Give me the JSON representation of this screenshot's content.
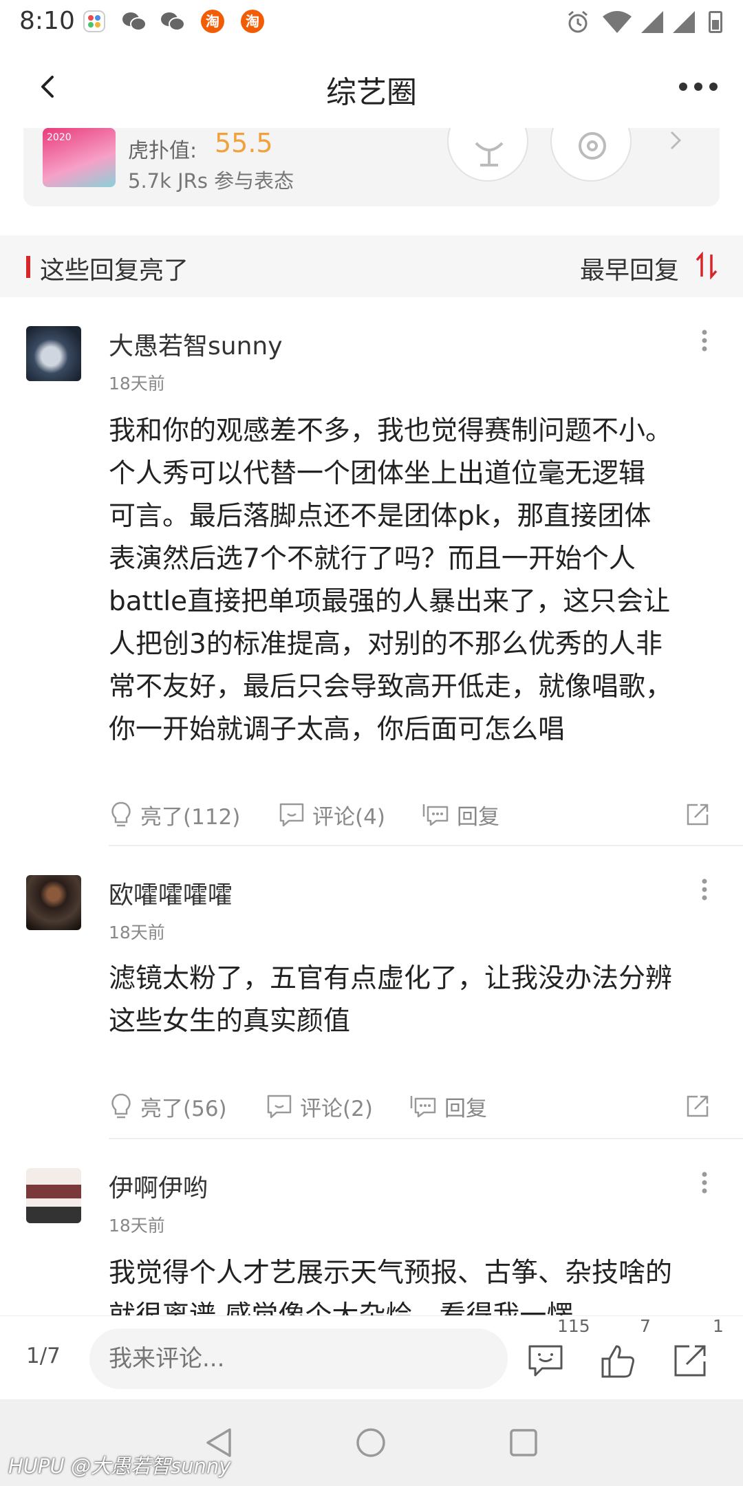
{
  "status_bar": {
    "time": "8:10"
  },
  "nav": {
    "title": "综艺圈"
  },
  "top_card": {
    "thumb_text": "2020",
    "hupu_label": "虎扑值:",
    "hupu_value": "55.5",
    "jrs_text": "5.7k  JRs 参与表态"
  },
  "section": {
    "title": "这些回复亮了",
    "sort_label": "最早回复"
  },
  "comments": [
    {
      "user": "大愚若智sunny",
      "time": "18天前",
      "lines": [
        "我和你的观感差不多，我也觉得赛制问题不小。",
        "个人秀可以代替一个团体坐上出道位毫无逻辑",
        "可言。最后落脚点还不是团体pk，那直接团体",
        "表演然后选7个不就行了吗？而且一开始个人",
        "battle直接把单项最强的人暴出来了，这只会让",
        "人把创3的标准提高，对别的不那么优秀的人非",
        "常不友好，最后只会导致高开低走，就像唱歌，",
        "你一开始就调子太高，你后面可怎么唱"
      ],
      "likes": "亮了(112)",
      "comments": "评论(4)",
      "reply": "回复"
    },
    {
      "user": "欧嚯嚯嚯嚯",
      "time": "18天前",
      "lines": [
        "滤镜太粉了，五官有点虚化了，让我没办法分辨",
        "这些女生的真实颜值"
      ],
      "likes": "亮了(56)",
      "comments": "评论(2)",
      "reply": "回复"
    },
    {
      "user": "伊啊伊哟",
      "time": "18天前",
      "lines": [
        "我觉得个人才艺展示天气预报、古筝、杂技啥的",
        "就很离谱        感觉像个大杂烩，看得我一愣"
      ]
    }
  ],
  "bottom_bar": {
    "pager": "1/7",
    "input_placeholder": "我来评论...",
    "comment_count": "115",
    "like_count": "7",
    "share_count": "1"
  },
  "watermark": "HUPU @大愚若智sunny",
  "colors": {
    "accent_red": "#d6262a",
    "hupu_orange": "#f2a13a"
  }
}
